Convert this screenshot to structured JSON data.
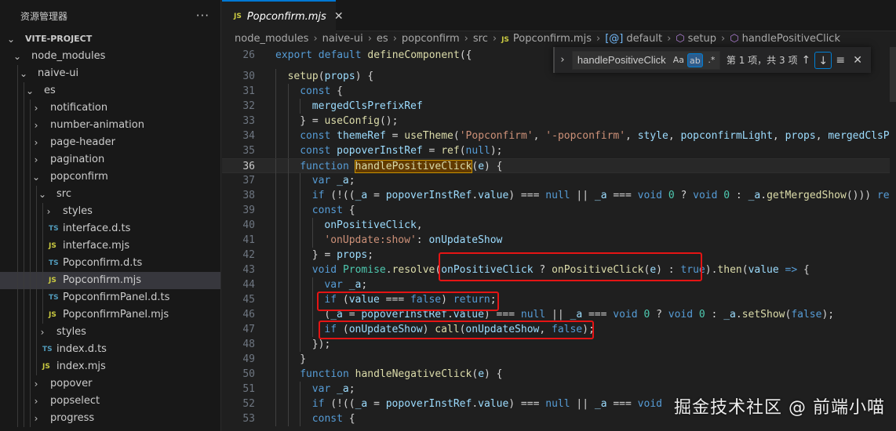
{
  "sidebar": {
    "title": "资源管理器",
    "more": "···",
    "tree": [
      {
        "label": "VITE-PROJECT",
        "depth": 0,
        "chevron": "open",
        "root": true
      },
      {
        "label": "node_modules",
        "depth": 1,
        "chevron": "open"
      },
      {
        "label": "naive-ui",
        "depth": 2,
        "chevron": "open"
      },
      {
        "label": "es",
        "depth": 3,
        "chevron": "open"
      },
      {
        "label": "notification",
        "depth": 4,
        "chevron": "closed"
      },
      {
        "label": "number-animation",
        "depth": 4,
        "chevron": "closed"
      },
      {
        "label": "page-header",
        "depth": 4,
        "chevron": "closed"
      },
      {
        "label": "pagination",
        "depth": 4,
        "chevron": "closed"
      },
      {
        "label": "popconfirm",
        "depth": 4,
        "chevron": "open"
      },
      {
        "label": "src",
        "depth": 5,
        "chevron": "open"
      },
      {
        "label": "styles",
        "depth": 6,
        "chevron": "closed"
      },
      {
        "label": "interface.d.ts",
        "depth": 6,
        "type": "TS"
      },
      {
        "label": "interface.mjs",
        "depth": 6,
        "type": "JS"
      },
      {
        "label": "Popconfirm.d.ts",
        "depth": 6,
        "type": "TS"
      },
      {
        "label": "Popconfirm.mjs",
        "depth": 6,
        "type": "JS",
        "selected": true
      },
      {
        "label": "PopconfirmPanel.d.ts",
        "depth": 6,
        "type": "TS"
      },
      {
        "label": "PopconfirmPanel.mjs",
        "depth": 6,
        "type": "JS"
      },
      {
        "label": "styles",
        "depth": 5,
        "chevron": "closed"
      },
      {
        "label": "index.d.ts",
        "depth": 5,
        "type": "TS"
      },
      {
        "label": "index.mjs",
        "depth": 5,
        "type": "JS"
      },
      {
        "label": "popover",
        "depth": 4,
        "chevron": "closed"
      },
      {
        "label": "popselect",
        "depth": 4,
        "chevron": "closed"
      },
      {
        "label": "progress",
        "depth": 4,
        "chevron": "closed"
      }
    ]
  },
  "tab": {
    "icon": "JS",
    "name": "Popconfirm.mjs",
    "close": "✕"
  },
  "breadcrumb": {
    "items": [
      "node_modules",
      "naive-ui",
      "es",
      "popconfirm",
      "src"
    ],
    "file_icon": "JS",
    "file": "Popconfirm.mjs",
    "symbols": [
      {
        "icon": "[@]",
        "label": "default"
      },
      {
        "icon": "⬡",
        "label": "setup"
      },
      {
        "icon": "⬡",
        "label": "handlePositiveClick"
      }
    ]
  },
  "find": {
    "toggle": "›",
    "value": "handlePositiveClick",
    "opt_case": "Aa",
    "opt_word": "ab",
    "opt_regex": ".*",
    "count": "第 1 项，共 3 项",
    "prev": "↑",
    "next": "↓",
    "selection": "≡",
    "close": "✕"
  },
  "code": {
    "current_line": "36",
    "lines": [
      {
        "n": "26",
        "indent": 0,
        "html": "<span class='k'>export</span> <span class='k'>default</span> <span class='f'>defineComponent</span><span class='p'>({</span>"
      },
      {
        "n": "30",
        "indent": 1,
        "html": "<span class='f'>setup</span><span class='p'>(</span><span class='v'>props</span><span class='p'>) {</span>"
      },
      {
        "n": "31",
        "indent": 2,
        "html": "<span class='k'>const</span> <span class='p'>{</span>"
      },
      {
        "n": "32",
        "indent": 3,
        "html": "<span class='v'>mergedClsPrefixRef</span>"
      },
      {
        "n": "33",
        "indent": 2,
        "html": "<span class='p'>} = </span><span class='f'>useConfig</span><span class='p'>();</span>"
      },
      {
        "n": "34",
        "indent": 2,
        "html": "<span class='k'>const</span> <span class='v'>themeRef</span><span class='p'> = </span><span class='f'>useTheme</span><span class='p'>(</span><span class='s'>'Popconfirm'</span><span class='p'>, </span><span class='s'>'-popconfirm'</span><span class='p'>, </span><span class='v'>style</span><span class='p'>, </span><span class='v'>popconfirmLight</span><span class='p'>, </span><span class='v'>props</span><span class='p'>, </span><span class='v'>mergedClsPre</span>"
      },
      {
        "n": "35",
        "indent": 2,
        "html": "<span class='k'>const</span> <span class='v'>popoverInstRef</span><span class='p'> = </span><span class='f'>ref</span><span class='p'>(</span><span class='k'>null</span><span class='p'>);</span>"
      },
      {
        "n": "36",
        "indent": 2,
        "html": "<span class='k'>function</span> <span class='f hl'>handlePositiveClick</span><span class='p'>(</span><span class='v'>e</span><span class='p'>) {</span>"
      },
      {
        "n": "37",
        "indent": 3,
        "html": "<span class='k'>var</span> <span class='v'>_a</span><span class='p'>;</span>"
      },
      {
        "n": "38",
        "indent": 3,
        "html": "<span class='k'>if</span> <span class='p'>(!((</span><span class='v'>_a</span><span class='p'> = </span><span class='v'>popoverInstRef</span><span class='p'>.</span><span class='v'>value</span><span class='p'>) === </span><span class='k'>null</span><span class='p'> || </span><span class='v'>_a</span><span class='p'> === </span><span class='k'>void</span> <span class='c2'>0</span><span class='p'> ? </span><span class='k'>void</span> <span class='c2'>0</span><span class='p'> : </span><span class='v'>_a</span><span class='p'>.</span><span class='f'>getMergedShow</span><span class='p'>())) </span><span class='k'>retu</span>"
      },
      {
        "n": "39",
        "indent": 3,
        "html": "<span class='k'>const</span> <span class='p'>{</span>"
      },
      {
        "n": "40",
        "indent": 4,
        "html": "<span class='v'>onPositiveClick</span><span class='p'>,</span>"
      },
      {
        "n": "41",
        "indent": 4,
        "html": "<span class='s'>'onUpdate:show'</span><span class='p'>: </span><span class='v'>onUpdateShow</span>"
      },
      {
        "n": "42",
        "indent": 3,
        "html": "<span class='p'>} = </span><span class='v'>props</span><span class='p'>;</span>"
      },
      {
        "n": "43",
        "indent": 3,
        "html": "<span class='k'>void</span> <span class='c2'>Promise</span><span class='p'>.</span><span class='f'>resolve</span><span class='p'>(</span><span class='v'>onPositiveClick</span><span class='p'> ? </span><span class='f'>onPositiveClick</span><span class='p'>(</span><span class='v'>e</span><span class='p'>) : </span><span class='k'>true</span><span class='p'>).</span><span class='f'>then</span><span class='p'>(</span><span class='v'>value</span> <span class='k'>=&gt;</span> <span class='p'>{</span>"
      },
      {
        "n": "44",
        "indent": 4,
        "html": "<span class='k'>var</span> <span class='v'>_a</span><span class='p'>;</span>"
      },
      {
        "n": "45",
        "indent": 4,
        "html": "<span class='k'>if</span> <span class='p'>(</span><span class='v'>value</span><span class='p'> === </span><span class='k'>false</span><span class='p'>) </span><span class='k'>return</span><span class='p'>;</span>"
      },
      {
        "n": "46",
        "indent": 4,
        "html": "<span class='p'>(</span><span class='v'>_a</span><span class='p'> = </span><span class='v'>popoverInstRef</span><span class='p'>.</span><span class='v'>value</span><span class='p'>) === </span><span class='k'>null</span><span class='p'> || </span><span class='v'>_a</span><span class='p'> === </span><span class='k'>void</span> <span class='c2'>0</span><span class='p'> ? </span><span class='k'>void</span> <span class='c2'>0</span><span class='p'> : </span><span class='v'>_a</span><span class='p'>.</span><span class='f'>setShow</span><span class='p'>(</span><span class='k'>false</span><span class='p'>);</span>"
      },
      {
        "n": "47",
        "indent": 4,
        "html": "<span class='k'>if</span> <span class='p'>(</span><span class='v'>onUpdateShow</span><span class='p'>) </span><span class='f'>call</span><span class='p'>(</span><span class='v'>onUpdateShow</span><span class='p'>, </span><span class='k'>false</span><span class='p'>);</span>"
      },
      {
        "n": "48",
        "indent": 3,
        "html": "<span class='p'>});</span>"
      },
      {
        "n": "49",
        "indent": 2,
        "html": "<span class='p'>}</span>"
      },
      {
        "n": "50",
        "indent": 2,
        "html": "<span class='k'>function</span> <span class='f'>handleNegativeClick</span><span class='p'>(</span><span class='v'>e</span><span class='p'>) {</span>"
      },
      {
        "n": "51",
        "indent": 3,
        "html": "<span class='k'>var</span> <span class='v'>_a</span><span class='p'>;</span>"
      },
      {
        "n": "52",
        "indent": 3,
        "html": "<span class='k'>if</span> <span class='p'>(!((</span><span class='v'>_a</span><span class='p'> = </span><span class='v'>popoverInstRef</span><span class='p'>.</span><span class='v'>value</span><span class='p'>) === </span><span class='k'>null</span><span class='p'> || </span><span class='v'>_a</span><span class='p'> === </span><span class='k'>void</span><span class='p'>  </span>"
      },
      {
        "n": "53",
        "indent": 3,
        "html": "<span class='k'>const</span> <span class='p'>{</span>"
      }
    ]
  },
  "watermark": "掘金技术社区 @ 前端小喵"
}
